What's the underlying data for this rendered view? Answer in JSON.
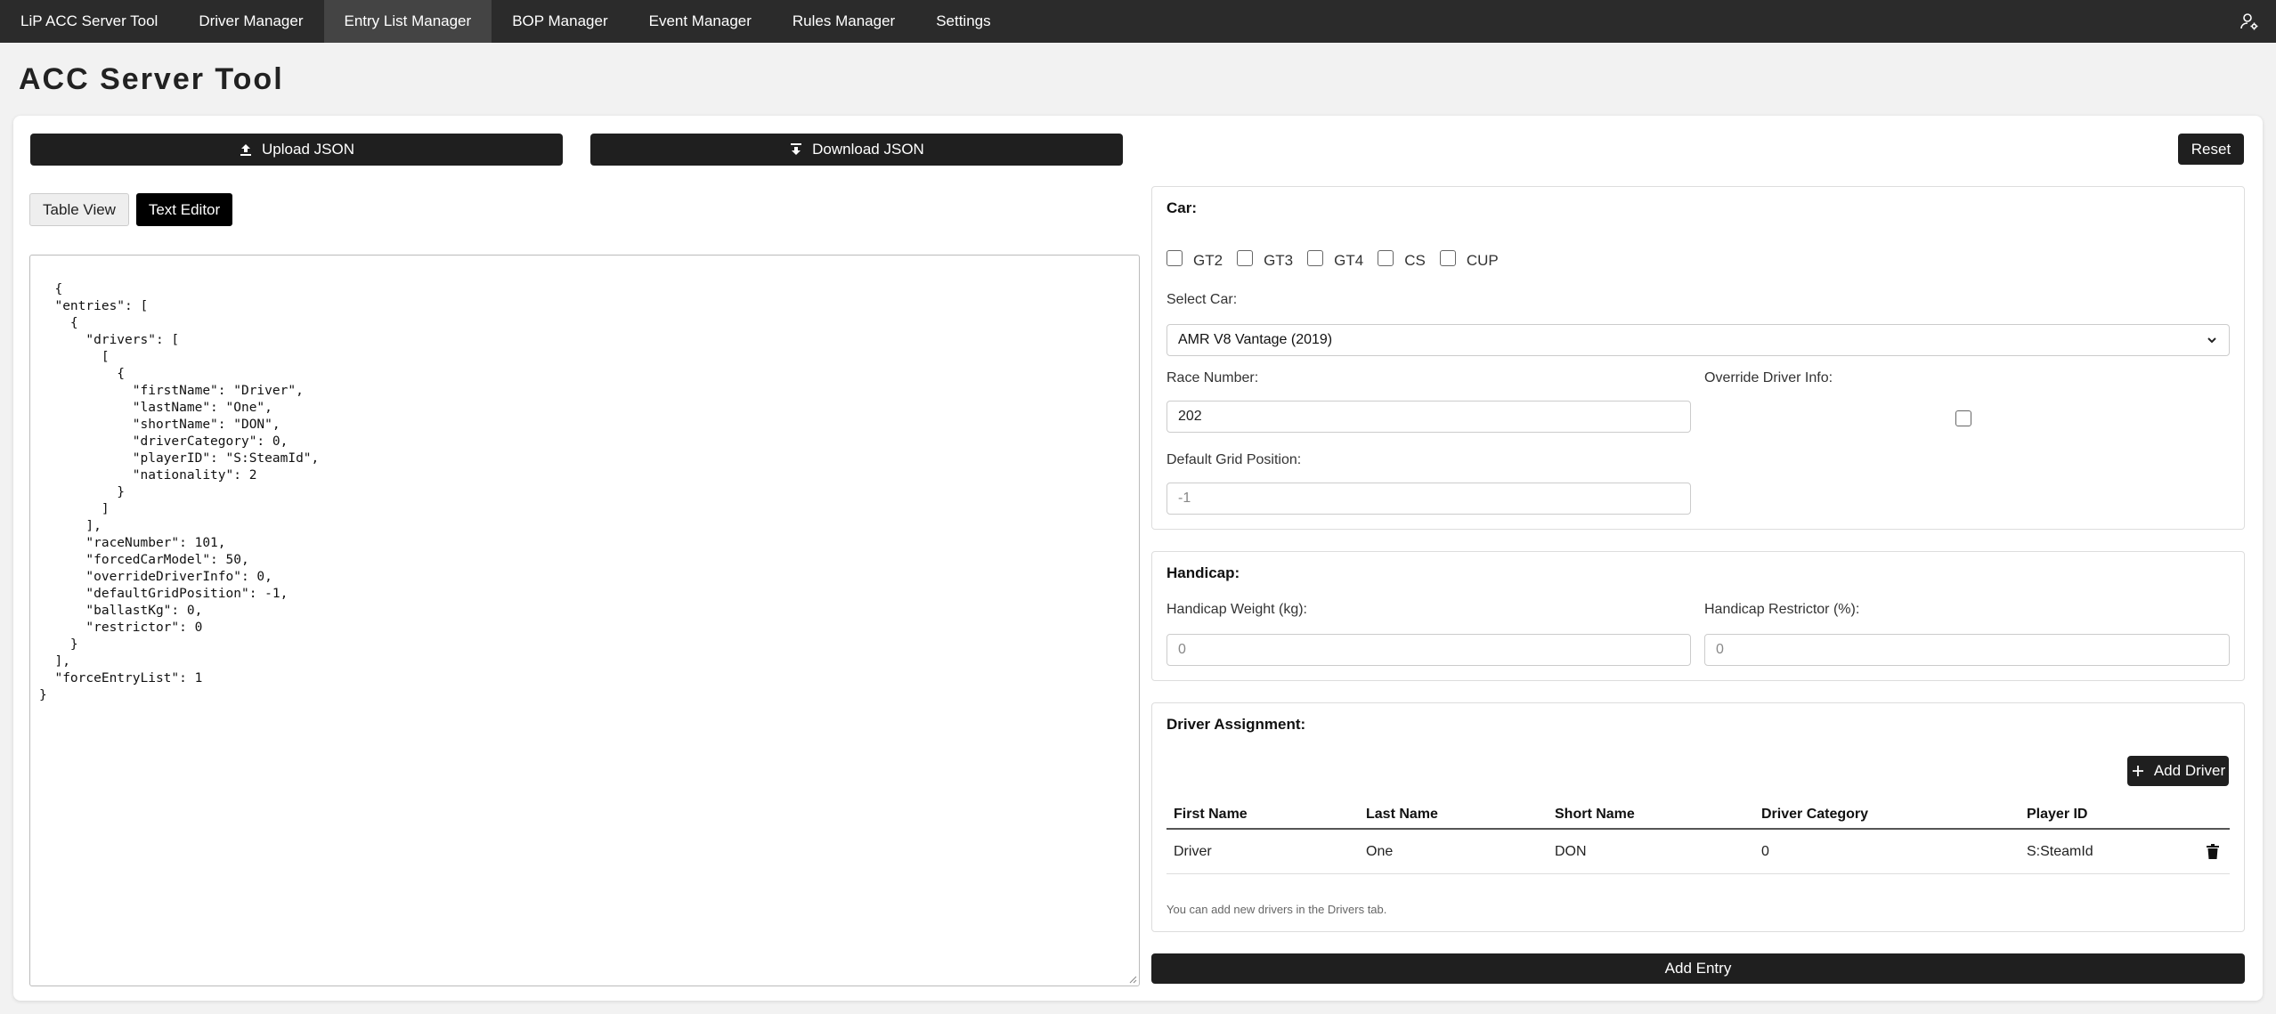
{
  "nav": {
    "items": [
      {
        "label": "LiP ACC Server Tool"
      },
      {
        "label": "Driver Manager"
      },
      {
        "label": "Entry List Manager"
      },
      {
        "label": "BOP Manager"
      },
      {
        "label": "Event Manager"
      },
      {
        "label": "Rules Manager"
      },
      {
        "label": "Settings"
      }
    ],
    "active": "Entry List Manager",
    "user_icon": "user-settings-icon"
  },
  "page": {
    "title": "ACC Server Tool"
  },
  "toolbar": {
    "upload_label": "Upload JSON",
    "download_label": "Download JSON",
    "reset_label": "Reset"
  },
  "view_tabs": {
    "table_label": "Table View",
    "text_label": "Text Editor",
    "active": "Text Editor"
  },
  "editor": {
    "content": "{\n  \"entries\": [\n    {\n      \"drivers\": [\n        [\n          {\n            \"firstName\": \"Driver\",\n            \"lastName\": \"One\",\n            \"shortName\": \"DON\",\n            \"driverCategory\": 0,\n            \"playerID\": \"S:SteamId\",\n            \"nationality\": 2\n          }\n        ]\n      ],\n      \"raceNumber\": 101,\n      \"forcedCarModel\": 50,\n      \"overrideDriverInfo\": 0,\n      \"defaultGridPosition\": -1,\n      \"ballastKg\": 0,\n      \"restrictor\": 0\n    }\n  ],\n  \"forceEntryList\": 1\n}"
  },
  "car": {
    "title": "Car:",
    "classes": [
      {
        "label": "GT2",
        "checked": false
      },
      {
        "label": "GT3",
        "checked": false
      },
      {
        "label": "GT4",
        "checked": false
      },
      {
        "label": "CS",
        "checked": false
      },
      {
        "label": "CUP",
        "checked": false
      }
    ],
    "select_label": "Select Car:",
    "selected_car": "AMR V8 Vantage (2019)",
    "race_number_label": "Race Number:",
    "race_number": "202",
    "override_label": "Override Driver Info:",
    "override_checked": false,
    "grid_label": "Default Grid Position:",
    "grid_placeholder": "-1"
  },
  "handicap": {
    "title": "Handicap:",
    "weight_label": "Handicap Weight (kg):",
    "weight_placeholder": "0",
    "restrictor_label": "Handicap Restrictor (%):",
    "restrictor_placeholder": "0"
  },
  "drivers": {
    "title": "Driver Assignment:",
    "add_label": "Add Driver",
    "columns": [
      "First Name",
      "Last Name",
      "Short Name",
      "Driver Category",
      "Player ID"
    ],
    "rows": [
      {
        "first": "Driver",
        "last": "One",
        "short": "DON",
        "category": "0",
        "player_id": "S:SteamId"
      }
    ],
    "hint": "You can add new drivers in the Drivers tab."
  },
  "footer": {
    "add_entry_label": "Add Entry"
  },
  "colors": {
    "nav_bg": "#2b2b2b",
    "button_dark": "#1f1f1f",
    "page_bg": "#f2f2f2"
  }
}
